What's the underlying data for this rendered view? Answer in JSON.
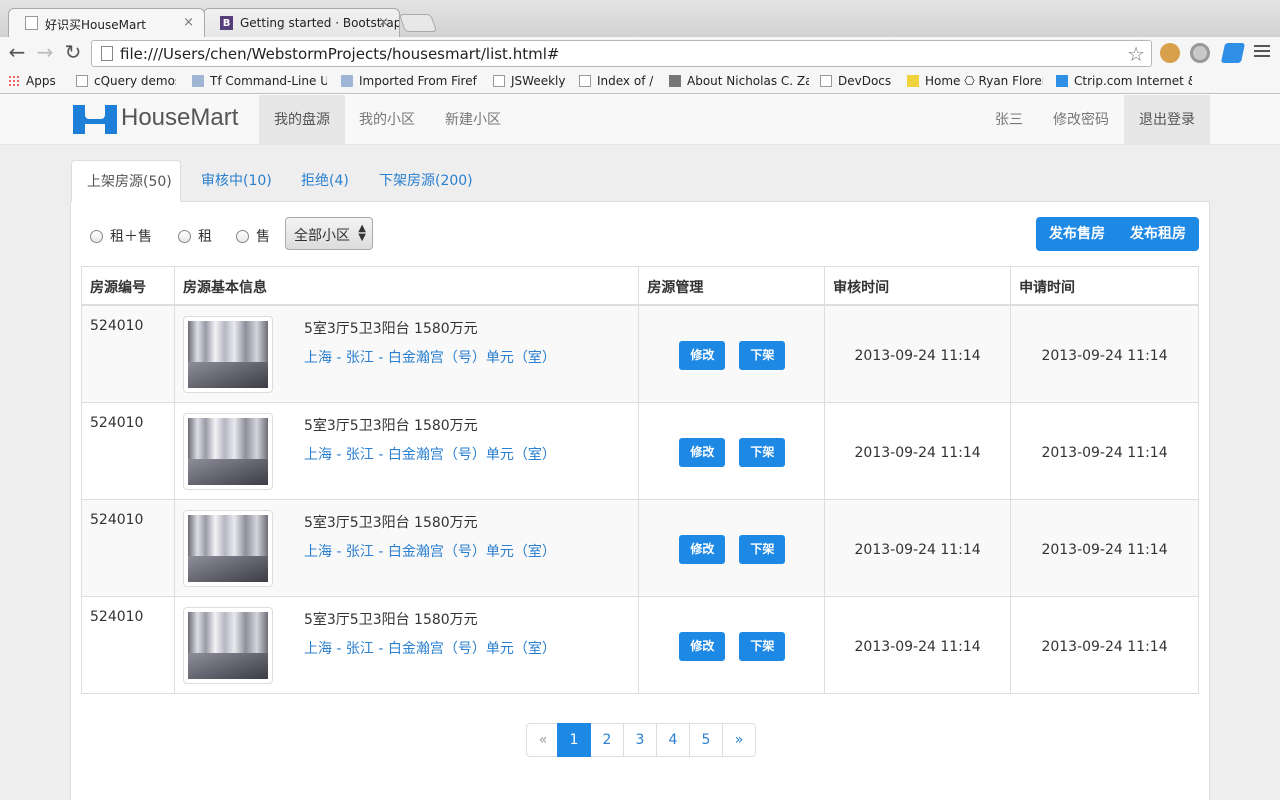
{
  "browser": {
    "tabs": [
      {
        "title": "好识买HouseMart",
        "close": "×"
      },
      {
        "title": "Getting started · Bootstrap",
        "close": "×",
        "icon_letter": "B"
      }
    ],
    "url": "file:///Users/chen/WebstormProjects/housesmart/list.html#",
    "bookmarks": [
      "Apps",
      "cQuery demos",
      "Tf Command-Line U",
      "Imported From Firef",
      "JSWeekly",
      "Index of /",
      "About Nicholas C. Za",
      "DevDocs",
      "Home ⎔ Ryan Floren",
      "Ctrip.com Internet &"
    ]
  },
  "app": {
    "logo": "HouseMart",
    "nav": [
      "我的盘源",
      "我的小区",
      "新建小区"
    ],
    "user": [
      "张三",
      "修改密码",
      "退出登录"
    ]
  },
  "tabs": [
    "上架房源(50)",
    "审核中(10)",
    "拒绝(4)",
    "下架房源(200)"
  ],
  "filters": {
    "radios": [
      "租＋售",
      "租",
      "售"
    ],
    "select_value": "全部小区"
  },
  "actions": {
    "sell": "发布售房",
    "rent": "发布租房"
  },
  "table": {
    "headers": [
      "房源编号",
      "房源基本信息",
      "房源管理",
      "审核时间",
      "申请时间"
    ],
    "rows": [
      {
        "id": "524010",
        "title": "5室3厅5卫3阳台 1580万元",
        "address": "上海 - 张江 - 白金瀚宫（号）单元（室）",
        "edit": "修改",
        "offline": "下架",
        "audit_time": "2013-09-24 11:14",
        "apply_time": "2013-09-24 11:14"
      },
      {
        "id": "524010",
        "title": "5室3厅5卫3阳台 1580万元",
        "address": "上海 - 张江 - 白金瀚宫（号）单元（室）",
        "edit": "修改",
        "offline": "下架",
        "audit_time": "2013-09-24 11:14",
        "apply_time": "2013-09-24 11:14"
      },
      {
        "id": "524010",
        "title": "5室3厅5卫3阳台 1580万元",
        "address": "上海 - 张江 - 白金瀚宫（号）单元（室）",
        "edit": "修改",
        "offline": "下架",
        "audit_time": "2013-09-24 11:14",
        "apply_time": "2013-09-24 11:14"
      },
      {
        "id": "524010",
        "title": "5室3厅5卫3阳台 1580万元",
        "address": "上海 - 张江 - 白金瀚宫（号）单元（室）",
        "edit": "修改",
        "offline": "下架",
        "audit_time": "2013-09-24 11:14",
        "apply_time": "2013-09-24 11:14"
      }
    ]
  },
  "pagination": {
    "prev": "«",
    "pages": [
      "1",
      "2",
      "3",
      "4",
      "5"
    ],
    "next": "»",
    "current": "1"
  },
  "colors": {
    "primary": "#1e88e5",
    "link": "#2a7fcf",
    "nav_bg": "#f8f8f8",
    "page_bg": "#eeeeee"
  }
}
